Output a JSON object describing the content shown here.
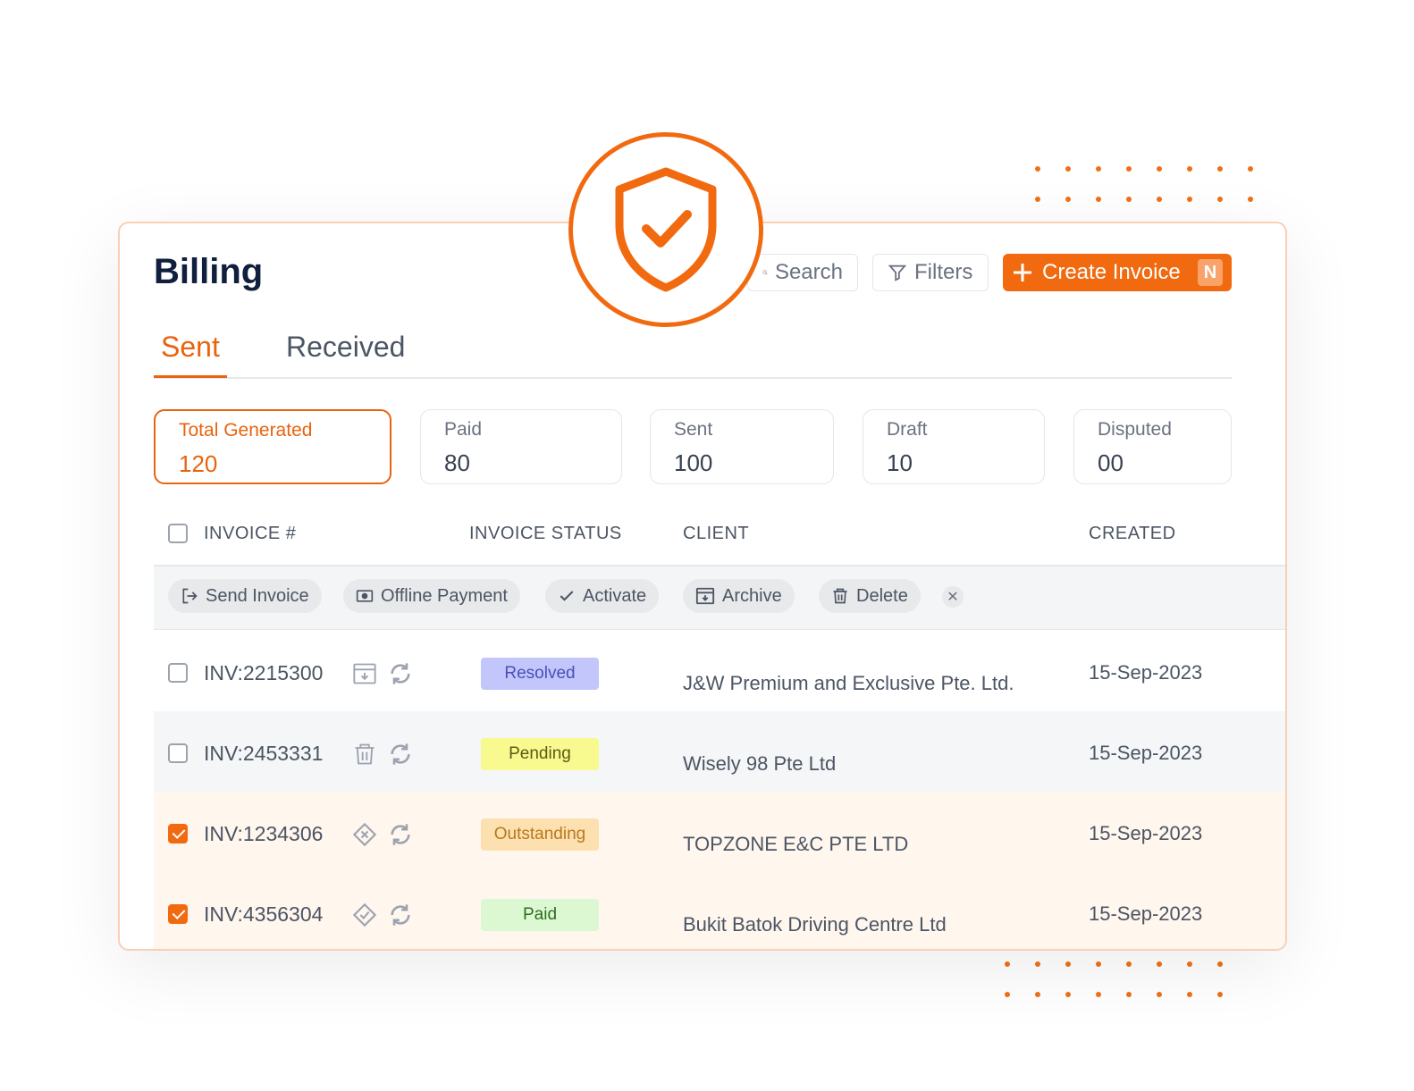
{
  "page": {
    "title": "Billing"
  },
  "toolbar": {
    "search_label": "Search",
    "filters_label": "Filters",
    "create_label": "Create Invoice",
    "create_shortcut": "N",
    "accent_color": "#f26a10"
  },
  "tabs": [
    {
      "label": "Sent",
      "active": true
    },
    {
      "label": "Received",
      "active": false
    }
  ],
  "stats": [
    {
      "label": "Total Generated",
      "value": "120",
      "active": true
    },
    {
      "label": "Paid",
      "value": "80"
    },
    {
      "label": "Sent",
      "value": "100"
    },
    {
      "label": "Draft",
      "value": "10"
    },
    {
      "label": "Disputed",
      "value": "00"
    }
  ],
  "table": {
    "columns": [
      "INVOICE #",
      "INVOICE STATUS",
      "CLIENT",
      "CREATED"
    ],
    "bulk_actions": [
      {
        "label": "Send Invoice",
        "icon": "send-icon"
      },
      {
        "label": "Offline Payment",
        "icon": "cash-icon"
      },
      {
        "label": "Activate",
        "icon": "check-icon"
      },
      {
        "label": "Archive",
        "icon": "archive-icon"
      },
      {
        "label": "Delete",
        "icon": "trash-icon"
      }
    ],
    "rows": [
      {
        "invoice": "INV:2215300",
        "status": "Resolved",
        "client": "J&W Premium and Exclusive Pte. Ltd.",
        "created": "15-Sep-2023",
        "checked": false,
        "icon": "archive-icon"
      },
      {
        "invoice": "INV:2453331",
        "status": "Pending",
        "client": "Wisely 98 Pte Ltd",
        "created": "15-Sep-2023",
        "checked": false,
        "icon": "trash-icon"
      },
      {
        "invoice": "INV:1234306",
        "status": "Outstanding",
        "client": "TOPZONE E&C PTE LTD",
        "created": "15-Sep-2023",
        "checked": true,
        "icon": "close-diamond-icon"
      },
      {
        "invoice": "INV:4356304",
        "status": "Paid",
        "client": "Bukit Batok Driving Centre Ltd",
        "created": "15-Sep-2023",
        "checked": true,
        "icon": "check-diamond-icon"
      }
    ],
    "status_colors": {
      "Resolved": {
        "bg": "#c2c6fb",
        "fg": "#4a4fb8"
      },
      "Pending": {
        "bg": "#f8f98e",
        "fg": "#5e5a14"
      },
      "Outstanding": {
        "bg": "#fde0b0",
        "fg": "#b8781e"
      },
      "Paid": {
        "bg": "#dcf8d2",
        "fg": "#2f6b22"
      }
    }
  }
}
